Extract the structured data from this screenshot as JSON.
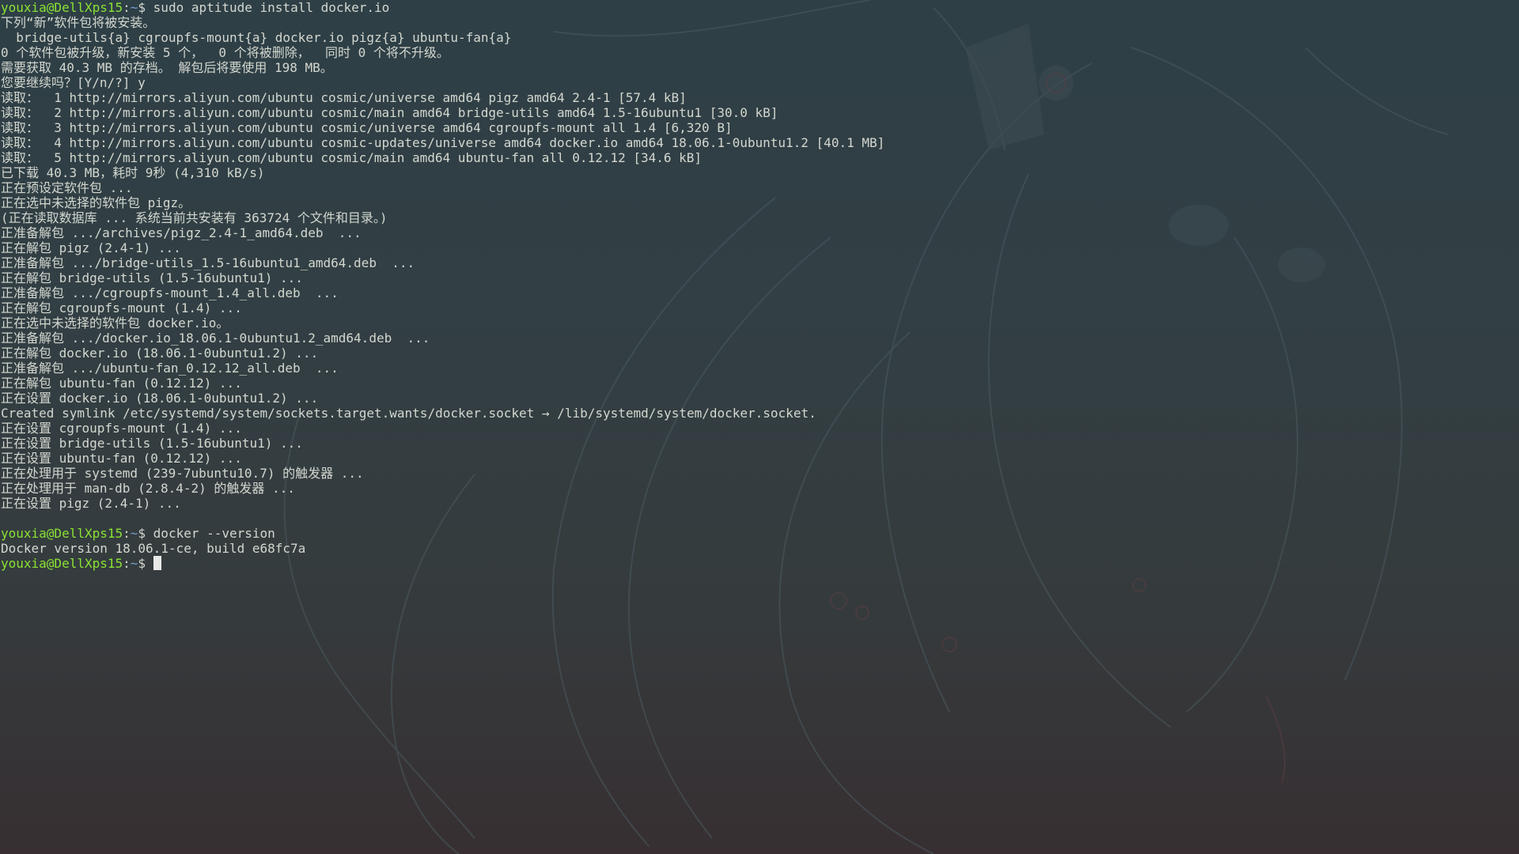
{
  "terminal": {
    "user_host": "youxia@DellXps15",
    "path": "~",
    "prompt_symbol": "$ ",
    "commands": {
      "c1": "sudo aptitude install docker.io",
      "c2": "docker --version"
    },
    "output": {
      "l1": "下列“新”软件包将被安装。",
      "l2": "  bridge-utils{a} cgroupfs-mount{a} docker.io pigz{a} ubuntu-fan{a}",
      "l3": "0 个软件包被升级，新安装 5 个，  0 个将被删除，  同时 0 个将不升级。",
      "l4": "需要获取 40.3 MB 的存档。 解包后将要使用 198 MB。",
      "l5": "您要继续吗？[Y/n/?] y",
      "l6": "读取：  1 http://mirrors.aliyun.com/ubuntu cosmic/universe amd64 pigz amd64 2.4-1 [57.4 kB]",
      "l7": "读取：  2 http://mirrors.aliyun.com/ubuntu cosmic/main amd64 bridge-utils amd64 1.5-16ubuntu1 [30.0 kB]",
      "l8": "读取：  3 http://mirrors.aliyun.com/ubuntu cosmic/universe amd64 cgroupfs-mount all 1.4 [6,320 B]",
      "l9": "读取：  4 http://mirrors.aliyun.com/ubuntu cosmic-updates/universe amd64 docker.io amd64 18.06.1-0ubuntu1.2 [40.1 MB]",
      "l10": "读取：  5 http://mirrors.aliyun.com/ubuntu cosmic/main amd64 ubuntu-fan all 0.12.12 [34.6 kB]",
      "l11": "已下载 40.3 MB，耗时 9秒 (4,310 kB/s)",
      "l12": "正在预设定软件包 ...",
      "l13": "正在选中未选择的软件包 pigz。",
      "l14": "(正在读取数据库 ... 系统当前共安装有 363724 个文件和目录。)",
      "l15": "正准备解包 .../archives/pigz_2.4-1_amd64.deb  ...",
      "l16": "正在解包 pigz (2.4-1) ...",
      "l17": "正准备解包 .../bridge-utils_1.5-16ubuntu1_amd64.deb  ...",
      "l18": "正在解包 bridge-utils (1.5-16ubuntu1) ...",
      "l19": "正准备解包 .../cgroupfs-mount_1.4_all.deb  ...",
      "l20": "正在解包 cgroupfs-mount (1.4) ...",
      "l21": "正在选中未选择的软件包 docker.io。",
      "l22": "正准备解包 .../docker.io_18.06.1-0ubuntu1.2_amd64.deb  ...",
      "l23": "正在解包 docker.io (18.06.1-0ubuntu1.2) ...",
      "l24": "正准备解包 .../ubuntu-fan_0.12.12_all.deb  ...",
      "l25": "正在解包 ubuntu-fan (0.12.12) ...",
      "l26": "正在设置 docker.io (18.06.1-0ubuntu1.2) ...",
      "l27": "Created symlink /etc/systemd/system/sockets.target.wants/docker.socket → /lib/systemd/system/docker.socket.",
      "l28": "正在设置 cgroupfs-mount (1.4) ...",
      "l29": "正在设置 bridge-utils (1.5-16ubuntu1) ...",
      "l30": "正在设置 ubuntu-fan (0.12.12) ...",
      "l31": "正在处理用于 systemd (239-7ubuntu10.7) 的触发器 ...",
      "l32": "正在处理用于 man-db (2.8.4-2) 的触发器 ...",
      "l33": "正在设置 pigz (2.4-1) ...",
      "l34": "Docker version 18.06.1-ce, build e68fc7a"
    }
  },
  "colors": {
    "prompt_user": "#8ae234",
    "prompt_path": "#729fcf",
    "text": "#d3d7cf",
    "background": "#323f44"
  }
}
